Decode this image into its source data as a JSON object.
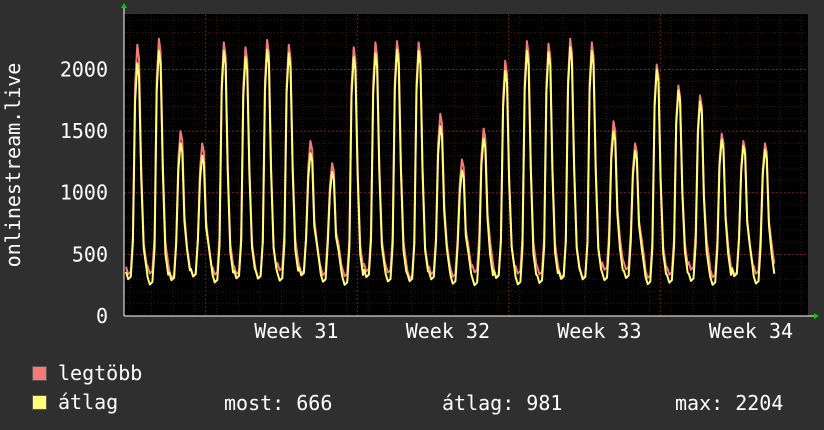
{
  "chart_data": {
    "type": "line",
    "ylabel": "onlinestream.live",
    "yticks": [
      0,
      500,
      1000,
      1500,
      2000
    ],
    "ylim": [
      0,
      2450
    ],
    "week_labels": [
      "Week 31",
      "Week 32",
      "Week 33",
      "Week 34"
    ],
    "grid": true,
    "legend_position": "bottom-left",
    "series": [
      {
        "name": "legtöbb",
        "color": "#f47a7a",
        "daily_peaks": [
          2200,
          2250,
          1500,
          1400,
          2220,
          2180,
          2240,
          2200,
          1420,
          1240,
          2180,
          2220,
          2230,
          2220,
          1640,
          1270,
          1520,
          2070,
          2230,
          2210,
          2250,
          2220,
          1580,
          1400,
          2040,
          1870,
          1790,
          1480,
          1420,
          1400
        ]
      },
      {
        "name": "átlag",
        "color": "#ffff7a",
        "daily_peaks": [
          2050,
          2150,
          1400,
          1300,
          2150,
          2100,
          2160,
          2130,
          1320,
          1170,
          2100,
          2130,
          2160,
          2150,
          1540,
          1180,
          1440,
          1990,
          2150,
          2140,
          2180,
          2150,
          1500,
          1340,
          2000,
          1830,
          1740,
          1430,
          1380,
          1350
        ]
      }
    ]
  },
  "legend": [
    {
      "label": "legtöbb",
      "color": "#f47a7a"
    },
    {
      "label": "átlag",
      "color": "#ffff7a"
    }
  ],
  "stats": {
    "now": "most: 666",
    "avg": "átlag: 981",
    "max": "max: 2204"
  }
}
